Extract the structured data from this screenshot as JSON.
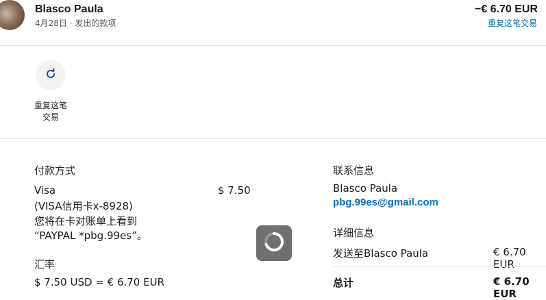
{
  "header": {
    "name": "Blasco Paula",
    "date": "4月28日",
    "separator": "·",
    "type": "发出的款项",
    "amount": "−€ 6.70 EUR",
    "repeat_link": "重复这笔交易"
  },
  "action": {
    "label_line1": "重复这笔",
    "label_line2": "交易",
    "icon": "refresh-icon"
  },
  "payment": {
    "title": "付款方式",
    "method": "Visa",
    "card": "(VISA信用卡x-8928)",
    "note_line1": "您将在卡对账单上看到",
    "note_line2": "“PAYPAL *pbg.99es”。",
    "amount": "$ 7.50"
  },
  "exchange": {
    "title": "汇率",
    "value": "$ 7.50 USD = € 6.70 EUR"
  },
  "contact": {
    "title": "联系信息",
    "name": "Blasco Paula",
    "email": "pbg.99es@gmail.com"
  },
  "details": {
    "title": "详细信息",
    "sent_to_label": "发送至Blasco Paula",
    "sent_to_amount": "€ 6.70 EUR",
    "total_label": "总计",
    "total_amount": "€ 6.70 EUR"
  },
  "colors": {
    "link": "#0070ba",
    "spinner_bg": "#646464"
  }
}
